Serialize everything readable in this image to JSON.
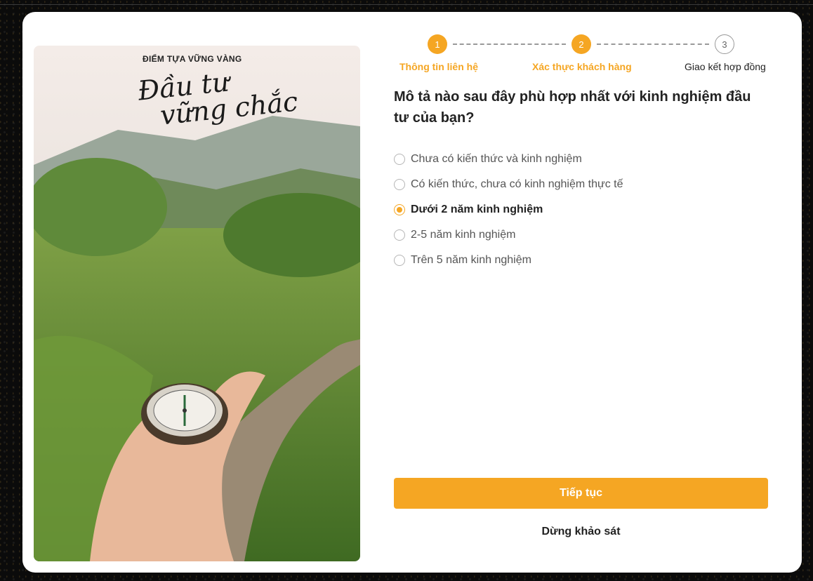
{
  "banner": {
    "tagline": "ĐIỂM TỰA VỮNG VÀNG",
    "script_line1": "Đầu tư",
    "script_line2": "vững chắc"
  },
  "stepper": {
    "steps": [
      {
        "number": "1",
        "label": "Thông tin liên hệ",
        "state": "done"
      },
      {
        "number": "2",
        "label": "Xác thực khách hàng",
        "state": "current"
      },
      {
        "number": "3",
        "label": "Giao kết hợp đồng",
        "state": "todo"
      }
    ]
  },
  "question": "Mô tả nào sau đây phù hợp nhất với kinh nghiệm đầu tư của bạn?",
  "options": [
    {
      "label": "Chưa có kiến thức và kinh nghiệm",
      "selected": false
    },
    {
      "label": "Có kiến thức, chưa có kinh nghiệm thực tế",
      "selected": false
    },
    {
      "label": "Dưới 2 năm kinh nghiệm",
      "selected": true
    },
    {
      "label": "2-5 năm kinh nghiệm",
      "selected": false
    },
    {
      "label": "Trên 5 năm kinh nghiệm",
      "selected": false
    }
  ],
  "actions": {
    "continue_label": "Tiếp tục",
    "stop_label": "Dừng khảo sát"
  },
  "colors": {
    "accent": "#f5a623",
    "text": "#222222",
    "muted": "#555555"
  }
}
